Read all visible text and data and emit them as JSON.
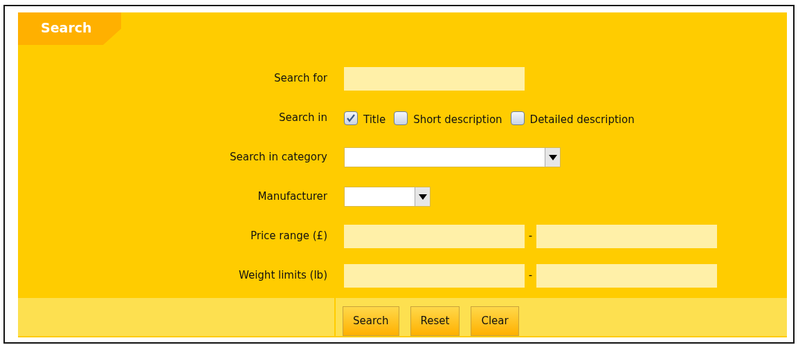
{
  "panel": {
    "title": "Search"
  },
  "fields": [
    {
      "kind": "text",
      "label": "Search for"
    },
    {
      "kind": "checkboxes",
      "label": "Search in",
      "options": [
        {
          "label": "Title",
          "checked": true
        },
        {
          "label": "Short description",
          "checked": false
        },
        {
          "label": "Detailed description",
          "checked": false
        }
      ]
    },
    {
      "kind": "select",
      "label": "Search in category"
    },
    {
      "kind": "smallselect",
      "label": "Manufacturer"
    },
    {
      "kind": "range",
      "label": "Price range (£)",
      "separator": "-"
    },
    {
      "kind": "range",
      "label": "Weight limits (lb)",
      "separator": "-"
    }
  ],
  "buttons": [
    "Search",
    "Reset",
    "Clear"
  ]
}
